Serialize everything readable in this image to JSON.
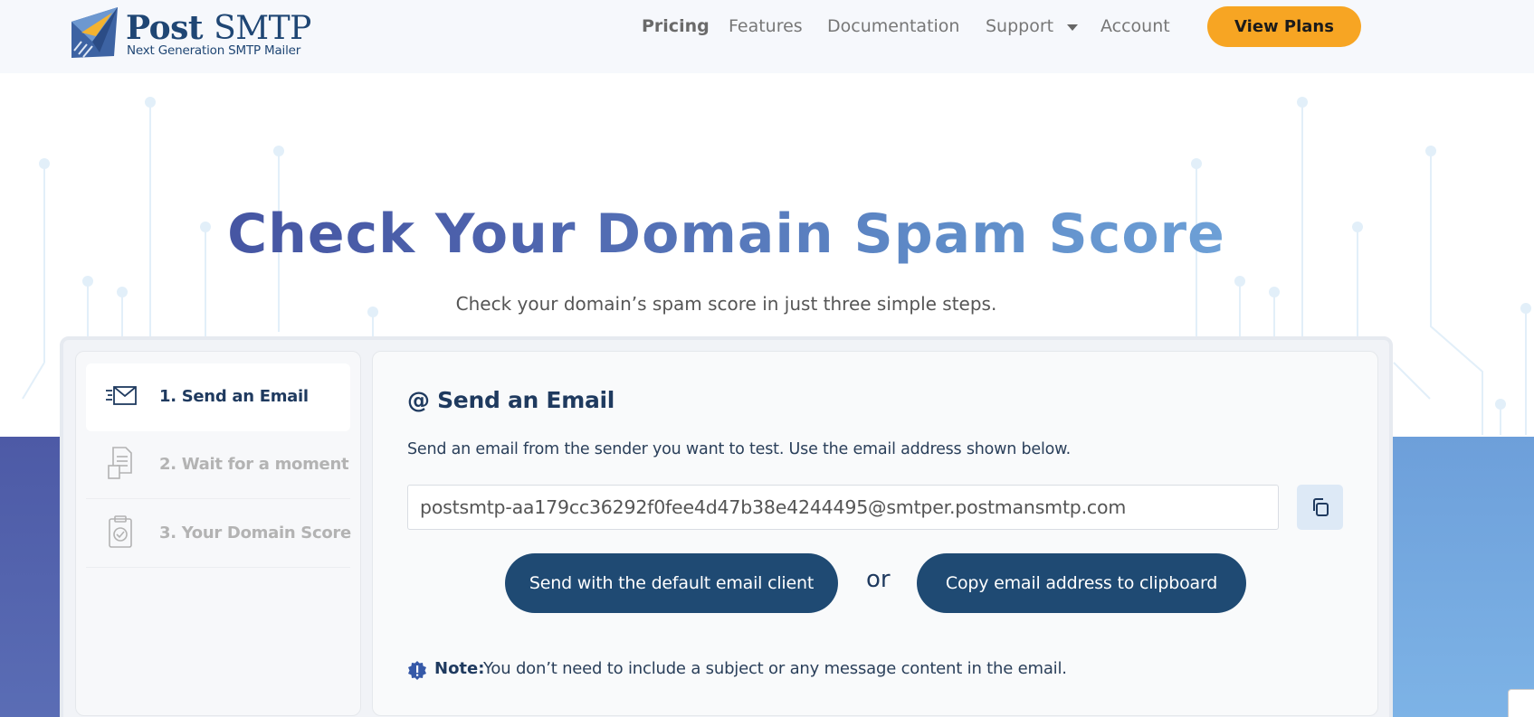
{
  "header": {
    "logo_title_bold": "Post",
    "logo_title_light": "SMTP",
    "logo_subtitle": "Next Generation SMTP Mailer",
    "nav": {
      "pricing": "Pricing",
      "features": "Features",
      "documentation": "Documentation",
      "support": "Support",
      "account": "Account"
    },
    "cta_label": "View Plans"
  },
  "hero": {
    "title": "Check Your Domain Spam Score",
    "subtitle": "Check your domain’s spam score in just three simple steps."
  },
  "steps": [
    {
      "label": "1. Send an Email",
      "icon": "send-email-icon",
      "active": true
    },
    {
      "label": "2. Wait for a moment",
      "icon": "document-wait-icon",
      "active": false
    },
    {
      "label": "3. Your Domain Score",
      "icon": "clipboard-check-icon",
      "active": false
    }
  ],
  "panel": {
    "title": "@ Send an Email",
    "description": "Send an email from the sender you want to test. Use the email address shown below.",
    "email_address": "postsmtp-aa179cc36292f0fee4d47b38e4244495@smtper.postmansmtp.com",
    "send_button": "Send with the default email client",
    "or_text": "or",
    "copy_button": "Copy email address to clipboard",
    "note_label": "Note:",
    "note_text": "You don’t need to include a subject or any message content in the email."
  },
  "colors": {
    "accent_orange": "#f7a523",
    "primary_navy": "#1f4a73",
    "title_gradient_start": "#3f4b9a",
    "title_gradient_end": "#79b0e2"
  }
}
